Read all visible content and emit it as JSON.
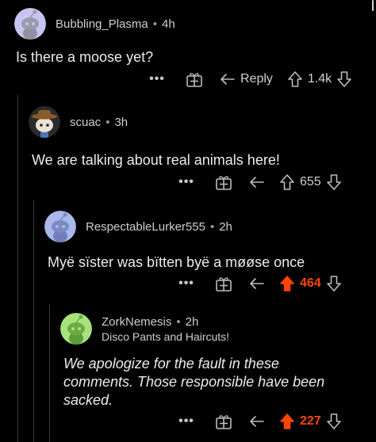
{
  "comments": [
    {
      "username": "Bubbling_Plasma",
      "time": "4h",
      "text": "Is there a moose yet?",
      "flair": "",
      "reply_label": "Reply",
      "score": "1.4k",
      "upvoted": false,
      "avatar_color": "#c7c4f2"
    },
    {
      "username": "scuac",
      "time": "3h",
      "text": "We are talking about real animals here!",
      "flair": "",
      "reply_label": "",
      "score": "655",
      "upvoted": false,
      "avatar_color": "#2a2a2a"
    },
    {
      "username": "RespectableLurker555",
      "time": "2h",
      "text": "Myë sïster was bïtten byë a møøse once",
      "flair": "",
      "reply_label": "",
      "score": "464",
      "upvoted": true,
      "avatar_color": "#a9b7ea"
    },
    {
      "username": "ZorkNemesis",
      "time": "2h",
      "flair": "Disco Pants and Haircuts!",
      "text_lines": [
        "We apologize for the fault in these",
        "comments.  Those responsible have been",
        "sacked."
      ],
      "reply_label": "",
      "score": "227",
      "upvoted": true,
      "avatar_color": "#a8e27a"
    }
  ],
  "ui": {
    "more_label": "•••",
    "separator": "•"
  },
  "colors": {
    "upvote": "#ff4500",
    "background": "#000000",
    "text": "#ececec"
  }
}
